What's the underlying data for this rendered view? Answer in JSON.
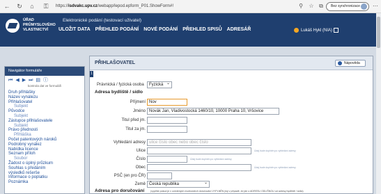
{
  "browser": {
    "url_prefix": "https://",
    "url_domain": "isdvakc.upv.cz",
    "url_path": "/webapp/lepod.epform_P01.ShowForm#!",
    "sync_label": "Bez synchronizace"
  },
  "header": {
    "logo_line1": "ÚŘAD",
    "logo_line2": "PRŮMYSLOVÉHO",
    "logo_line3": "VLASTNICTVÍ",
    "app_title": "Elektronické podání (testovací uživatel)",
    "nav": [
      "ULOŽIT DATA",
      "PŘEHLED PODÁNÍ",
      "NOVÉ PODÁNÍ",
      "PŘEHLED SPISŮ",
      "ADRESÁŘ"
    ],
    "user": "Lukáš Hykl (NIA)"
  },
  "sidebar": {
    "title": "Navigátor formuláře",
    "subtitle": "kontrola dat ve formuláři",
    "items": [
      {
        "label": "Druh přihlášky",
        "sub": false
      },
      {
        "label": "Název vynálezu",
        "sub": false
      },
      {
        "label": "Přihlašovatel",
        "sub": false
      },
      {
        "label": "Subjekt",
        "sub": true
      },
      {
        "label": "Původce",
        "sub": false
      },
      {
        "label": "Subjekt",
        "sub": true
      },
      {
        "label": "Zástupce přihlašovatele",
        "sub": false
      },
      {
        "label": "Subjekt",
        "sub": true
      },
      {
        "label": "Právo přednosti",
        "sub": false
      },
      {
        "label": "Přihláška",
        "sub": true
      },
      {
        "label": "Počet patentových nároků",
        "sub": false
      },
      {
        "label": "Podrobný vynález",
        "sub": false
      },
      {
        "label": "Nabídka licence",
        "sub": false
      },
      {
        "label": "Seznam příloh",
        "sub": false
      },
      {
        "label": "Soubor",
        "sub": true
      },
      {
        "label": "Žádost o úplný průzkum",
        "sub": false
      },
      {
        "label": "Souhlas s předáním",
        "sub": false
      },
      {
        "label": "výsledků rešerše",
        "sub": false
      },
      {
        "label": "Informace o poplatku",
        "sub": false
      },
      {
        "label": "Poznámka",
        "sub": false
      }
    ]
  },
  "panel": {
    "title": "PŘIHLAŠOVATEL",
    "help": "Nápověda",
    "marker": "1",
    "person_type_label": "Právnická / fyzická osoba",
    "person_type_value": "Fyzická",
    "address_section": "Adresa bydliště / sídlo",
    "fields": {
      "surname_label": "Příjmení",
      "surname_value": "Nov",
      "name_label": "Jméno",
      "name_value": "Novák Jan, Vladivostocká 1460/10, 10000 Praha 10, Vršovice",
      "title_before_label": "Titul před jm.",
      "title_after_label": "Titul za jm.",
      "search_address_label": "Vyhledání adresy",
      "search_address_placeholder": "ulice číslo obec nebo obec číslo",
      "street_label": "Ulice",
      "street_hint": "Údaj bude doplněn po vyhledání adresy",
      "number_label": "Číslo",
      "number_hint": "Údaj bude doplněn po vyhledání adresy",
      "city_label": "Obec",
      "city_hint": "Údaj bude doplněn po vyhledání adresy",
      "zip_label": "PSČ (en pro ČR)",
      "country_label": "Země",
      "country_value": "Česká republika"
    },
    "delivery_section": "Adresa pro doručování",
    "delivery_note": "(vyplňte pokud je v uvedených možnostech doručování VYPLNĚN jiný v případě, že jde o ADRESU ODLIŠNOU od adresy bydliště / sídla)"
  }
}
